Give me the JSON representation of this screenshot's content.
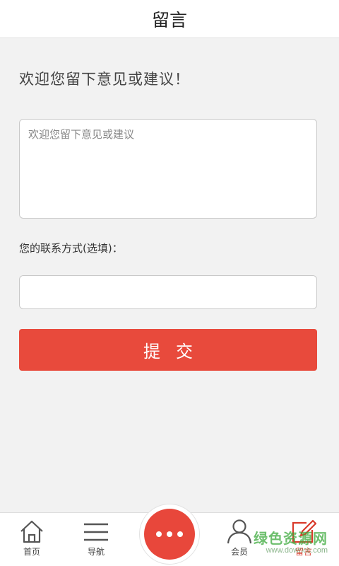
{
  "header": {
    "title": "留言"
  },
  "form": {
    "welcome_text": "欢迎您留下意见或建议！",
    "message_placeholder": "欢迎您留下意见或建议",
    "contact_label": "您的联系方式(选填)：",
    "contact_value": "",
    "submit_label": "提交"
  },
  "tabbar": {
    "items": [
      {
        "label": "首页",
        "icon": "home-icon"
      },
      {
        "label": "导航",
        "icon": "menu-icon"
      },
      {
        "label": "",
        "icon": "more-dots-icon"
      },
      {
        "label": "会员",
        "icon": "user-icon"
      },
      {
        "label": "留言",
        "icon": "edit-icon",
        "active": true
      }
    ]
  },
  "watermark": {
    "main": "绿色资源网",
    "sub": "www.downcc.com"
  },
  "colors": {
    "accent": "#e84a3c",
    "active_tab": "#d93a2b"
  }
}
